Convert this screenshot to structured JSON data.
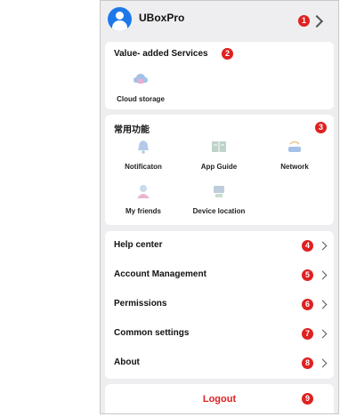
{
  "header": {
    "app_name": "UBoxPro",
    "badge": "1"
  },
  "value_added": {
    "title": "Value- added Services",
    "badge": "2",
    "items": [
      {
        "label": "Cloud storage",
        "icon": "cloud-storage-icon"
      }
    ]
  },
  "common": {
    "title": "常用功能",
    "badge": "3",
    "items": [
      {
        "label": "Notificaton",
        "icon": "bell-icon"
      },
      {
        "label": "App Guide",
        "icon": "book-icon"
      },
      {
        "label": "Network",
        "icon": "router-icon"
      },
      {
        "label": "My friends",
        "icon": "friends-icon"
      },
      {
        "label": "Device location",
        "icon": "location-icon"
      }
    ]
  },
  "menu": [
    {
      "label": "Help center",
      "badge": "4"
    },
    {
      "label": "Account Management",
      "badge": "5"
    },
    {
      "label": "Permissions",
      "badge": "6"
    },
    {
      "label": "Common settings",
      "badge": "7"
    },
    {
      "label": "About",
      "badge": "8"
    }
  ],
  "logout": {
    "label": "Logout",
    "badge": "9"
  },
  "colors": {
    "accent": "#1e78e8",
    "badge": "#e02020",
    "background": "#eeeef0"
  }
}
